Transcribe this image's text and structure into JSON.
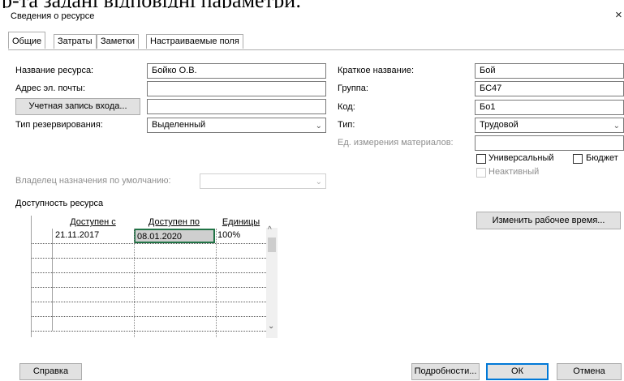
{
  "doc_text": "р-та задані відповідні параметри:",
  "dialog": {
    "title": "Сведения о ресурсе",
    "close_glyph": "×"
  },
  "tabs": [
    "Общие",
    "Затраты",
    "Заметки",
    "Настраиваемые поля"
  ],
  "fields": {
    "name_label": "Название ресурса:",
    "name_value": "Бойко О.В.",
    "email_label": "Адрес эл. почты:",
    "email_value": "",
    "account_button": "Учетная запись входа...",
    "account_value": "",
    "booking_label": "Тип резервирования:",
    "booking_value": "Выделенный",
    "short_name_label": "Краткое название:",
    "short_name_value": "Бой",
    "group_label": "Группа:",
    "group_value": "БС47",
    "code_label": "Код:",
    "code_value": "Бо1",
    "type_label": "Тип:",
    "type_value": "Трудовой",
    "material_label": "Ед. измерения материалов:",
    "material_value": "",
    "owner_label": "Владелец назначения по умолчанию:",
    "owner_value": ""
  },
  "checkboxes": {
    "generic": "Универсальный",
    "budget": "Бюджет",
    "inactive": "Неактивный"
  },
  "change_worktime_button": "Изменить рабочее время...",
  "availability": {
    "title": "Доступность ресурса",
    "columns": [
      "Доступен с",
      "Доступен по",
      "Единицы"
    ],
    "rows": [
      [
        "21.11.2017",
        "08.01.2020",
        "100%"
      ],
      [
        "",
        "",
        ""
      ],
      [
        "",
        "",
        ""
      ],
      [
        "",
        "",
        ""
      ],
      [
        "",
        "",
        ""
      ],
      [
        "",
        "",
        ""
      ],
      [
        "",
        "",
        ""
      ]
    ]
  },
  "footer": {
    "help": "Справка",
    "details": "Подробности...",
    "ok": "ОК",
    "cancel": "Отмена"
  },
  "glyphs": {
    "dropdown": "⌄",
    "scroll_up": "^",
    "scroll_down": "⌄"
  }
}
